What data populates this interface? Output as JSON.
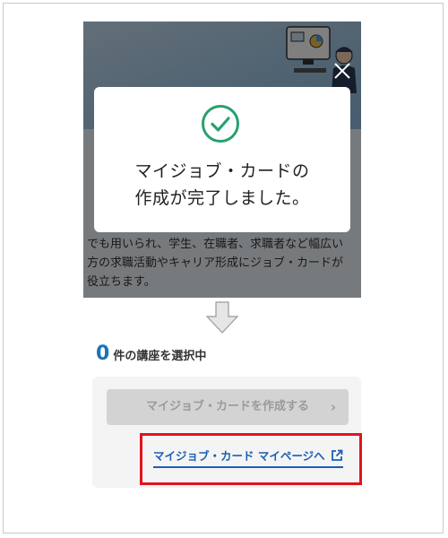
{
  "dialog": {
    "message_line1": "マイジョブ・カードの",
    "message_line2": "作成が完了しました。"
  },
  "hero": {
    "body_line1": "でも用いられ、学生、在職者、求職者など幅広い",
    "body_line2": "方の求職活動やキャリア形成にジョブ・カードが",
    "body_line3": "役立ちます。"
  },
  "selection": {
    "count": "0",
    "label": "件の講座を選択中"
  },
  "buttons": {
    "create_label": "マイジョブ・カードを作成する",
    "mypage_label": "マイジョブ・カード マイページへ"
  },
  "colors": {
    "accent_blue": "#1a73b8",
    "highlight_red": "#e0141e",
    "check_green": "#2aa06f",
    "disabled_gray": "#d3d3d3"
  }
}
